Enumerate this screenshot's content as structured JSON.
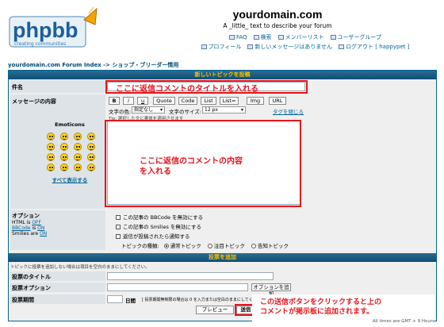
{
  "logo": {
    "text": "phpbb",
    "tagline": "creating communities"
  },
  "site": {
    "title": "yourdomain.com",
    "desc": "A _little_ text to describe your forum"
  },
  "nav": {
    "row1": [
      "FAQ",
      "検索",
      "メンバーリスト",
      "ユーザーグループ"
    ],
    "row2": [
      "プロフィール",
      "新しいメッセージはありません",
      "ログアウト [ happypet ]"
    ]
  },
  "breadcrumb": "yourdomain.com Forum Index -> ショップ・ブリーダー情用",
  "form": {
    "header": "新しいトピックを投稿",
    "subject_label": "件名",
    "subject_overlay": "ここに返信コメントのタイトルを入れる",
    "message_label": "メッセージの内容",
    "bbcode_buttons": [
      "B",
      "i",
      "u",
      "Quote",
      "Code",
      "List",
      "List=",
      "Img",
      "URL"
    ],
    "font_color_label": "文字の色:",
    "font_color_value": "指定なし",
    "font_size_label": "文字のサイズ:",
    "font_size_value": "12 px",
    "close_tags": "タグを閉じる",
    "tip": "Tip: 選択した文に書体を適用させます",
    "emoticons_title": "Emoticons",
    "emoticons_more": "すべて表示する",
    "message_overlay": [
      "ここに返信のコメントの内容",
      "を入れる"
    ],
    "options_label": "オプション",
    "html_status": "HTML is ",
    "html_value": "OFF",
    "bbcode_status": "BBCode",
    "bbcode_value": "ON",
    "bbcode_suffix": " is ",
    "smilies_status": "Smilies are ",
    "smilies_value": "ON",
    "opt_disable_bbcode": "この記事の BBCode を無効にする",
    "opt_disable_smilies": "この記事の Smilies を無効にする",
    "opt_notify": "返信が投稿されたら通知する",
    "topic_type_label": "トピックの種類:",
    "topic_types": [
      "通常トピック",
      "注目トピック",
      "告知トピック"
    ]
  },
  "poll": {
    "header": "投票を追加",
    "note": "トピックに投票を追加しない場合は項目を空白のままにしてください。",
    "title_label": "投票のタイトル",
    "option_label": "投票オプション",
    "add_option": "オプションを追加",
    "period_label": "投票期間",
    "days": "日間",
    "period_note": "[ 投票期間無制限の場合は 0 を入力または空白のままにしてください ]"
  },
  "actions": {
    "preview": "プレビュー",
    "submit": "送信"
  },
  "callout": [
    "この送信ボタンをクリックすると上の",
    "コメントが掲示板に追加されます。"
  ],
  "footnote": "All times are GMT + 9 Hours",
  "colors": {
    "accent": "#006699",
    "overlay": "#e8141b",
    "header_text": "#ffc000"
  }
}
